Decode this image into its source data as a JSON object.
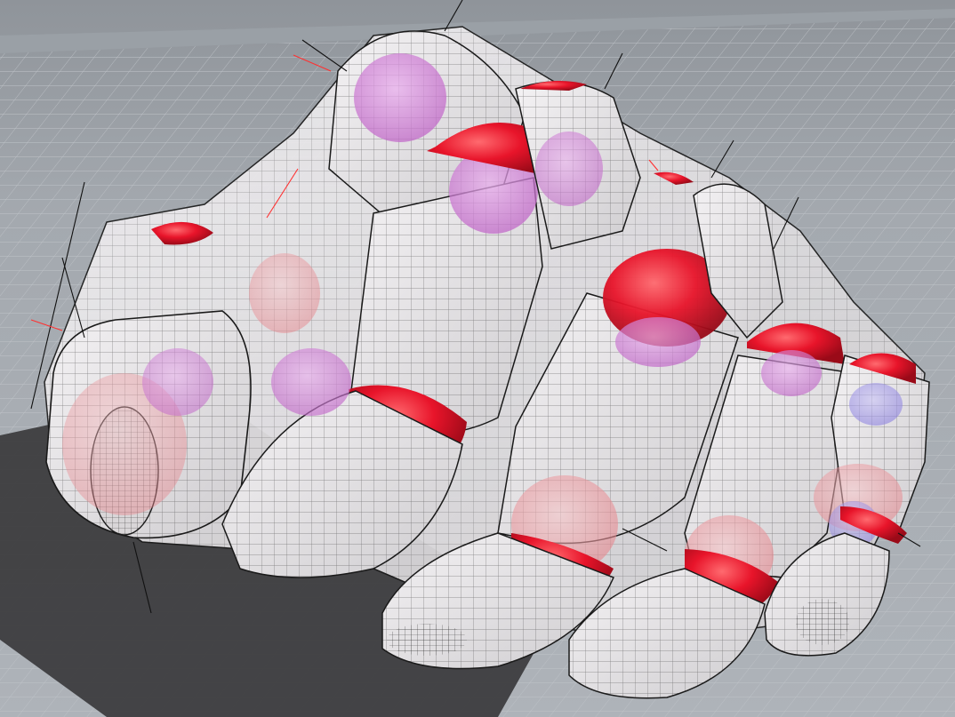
{
  "viewport": {
    "kind": "3d-modeling-viewport",
    "display_mode": "x-ray wireframe"
  },
  "colors": {
    "background": "#a6abb1",
    "grid_line": "#b9bdc2",
    "grid_major": "#c6cacf",
    "shadow": "#3d3d3f",
    "mesh_fill": "#e9e7e9",
    "mesh_wire": "#1a1a1a",
    "joint_red": "#e8142a",
    "joint_magenta": "#d48ad8",
    "joint_pink": "#ee9aa0",
    "joint_blue": "#9a90e8",
    "bone_axis": "#111111",
    "bone_axis_red": "#ff3030"
  },
  "icons": [
    "robotic-hand-mesh",
    "joint-sphere",
    "bone-axis-line"
  ]
}
